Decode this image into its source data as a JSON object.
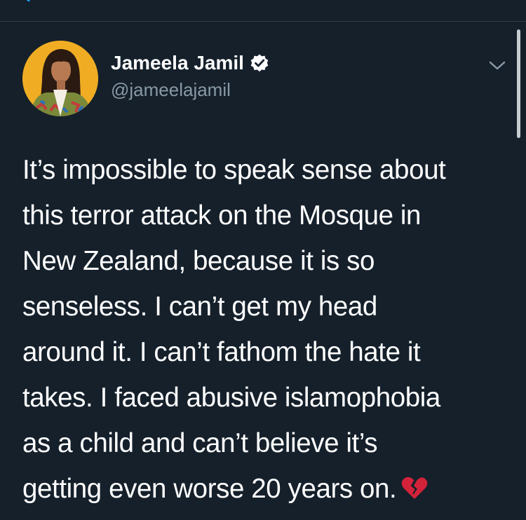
{
  "header": {
    "back_icon": "chevron-left-icon"
  },
  "tweet": {
    "author": {
      "display_name": "Jameela Jamil",
      "handle": "@jameelajamil",
      "verified": true,
      "verified_icon": "verified-badge-icon",
      "avatar_icon": "profile-photo"
    },
    "menu_icon": "chevron-down-icon",
    "text_lines": [
      "It’s impossible to speak sense about",
      "this terror attack on the Mosque in",
      "New Zealand, because it is so",
      "senseless. I can’t get my head",
      "around it. I can’t fathom the hate it",
      "takes. I faced abusive islamophobia",
      "as a child and can’t believe it’s",
      "getting even worse 20 years on."
    ],
    "emoji": "broken-heart-icon"
  },
  "colors": {
    "background": "#15202b",
    "text_primary": "#ffffff",
    "text_secondary": "#8899a6",
    "accent": "#1da1f2",
    "emoji": "#d3233a"
  }
}
